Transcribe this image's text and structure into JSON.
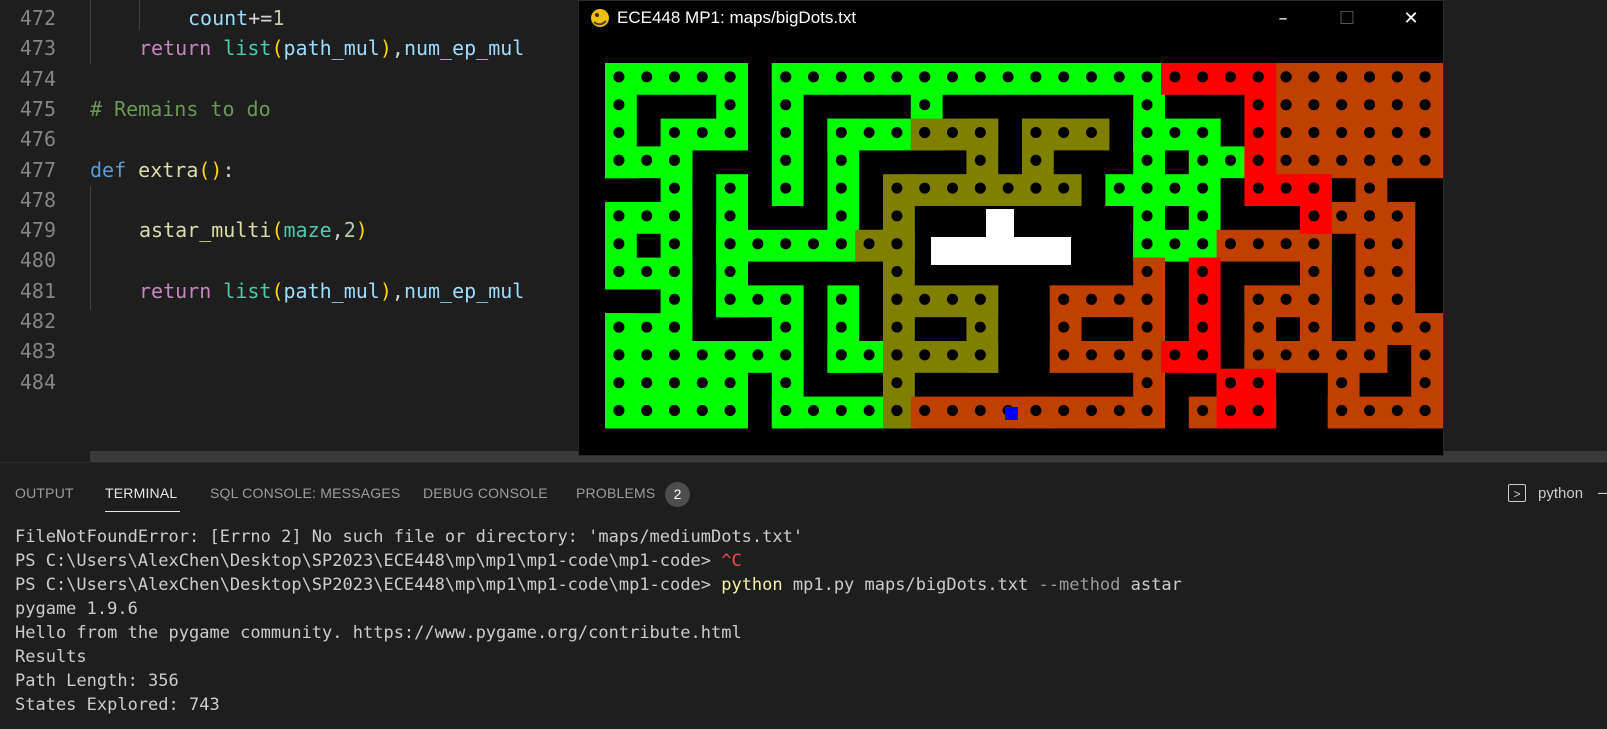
{
  "editor": {
    "lines": [
      {
        "num": "472",
        "indent": 4,
        "tokens": [
          [
            "var",
            "count"
          ],
          [
            "plain",
            "+="
          ],
          [
            "num",
            "1"
          ]
        ]
      },
      {
        "num": "473",
        "indent": 2,
        "tokens": [
          [
            "kw-ret",
            "return"
          ],
          [
            "plain",
            " "
          ],
          [
            "teal",
            "list"
          ],
          [
            "br",
            "("
          ],
          [
            "var",
            "path_mul"
          ],
          [
            "br",
            ")"
          ],
          [
            "plain",
            ","
          ],
          [
            "var",
            "num_ep_mul"
          ]
        ]
      },
      {
        "num": "474",
        "indent": 0,
        "tokens": []
      },
      {
        "num": "475",
        "indent": 0,
        "tokens": [
          [
            "cmt",
            "# Remains to do"
          ]
        ]
      },
      {
        "num": "476",
        "indent": 0,
        "tokens": []
      },
      {
        "num": "477",
        "indent": 0,
        "tokens": [
          [
            "kw-def",
            "def"
          ],
          [
            "plain",
            " "
          ],
          [
            "fn",
            "extra"
          ],
          [
            "br",
            "()"
          ],
          [
            "plain",
            ":"
          ]
        ]
      },
      {
        "num": "478",
        "indent": 0,
        "tokens": []
      },
      {
        "num": "479",
        "indent": 2,
        "tokens": [
          [
            "fn",
            "astar_multi"
          ],
          [
            "br",
            "("
          ],
          [
            "teal",
            "maze"
          ],
          [
            "plain",
            ","
          ],
          [
            "num",
            "2"
          ],
          [
            "br",
            ")"
          ]
        ]
      },
      {
        "num": "480",
        "indent": 0,
        "tokens": []
      },
      {
        "num": "481",
        "indent": 2,
        "tokens": [
          [
            "kw-ret",
            "return"
          ],
          [
            "plain",
            " "
          ],
          [
            "teal",
            "list"
          ],
          [
            "br",
            "("
          ],
          [
            "var",
            "path_mul"
          ],
          [
            "br",
            ")"
          ],
          [
            "plain",
            ","
          ],
          [
            "var",
            "num_ep_mul"
          ]
        ]
      },
      {
        "num": "482",
        "indent": 0,
        "tokens": []
      },
      {
        "num": "483",
        "indent": 0,
        "tokens": []
      },
      {
        "num": "484",
        "indent": 0,
        "tokens": []
      }
    ]
  },
  "game_window": {
    "title": "ECE448 MP1: maps/bigDots.txt",
    "minimize_icon": "minimize-icon",
    "maximize_icon": "maximize-icon",
    "close_icon": "close-icon",
    "colors": {
      "green": "#00ff00",
      "olive": "#7f7f00",
      "orange": "#c04000",
      "red": "#ff0000",
      "agent": "#0000ff",
      "wall": "#000000",
      "dot": "#000000"
    }
  },
  "panel": {
    "tabs": [
      "OUTPUT",
      "TERMINAL",
      "SQL CONSOLE: MESSAGES",
      "DEBUG CONSOLE",
      "PROBLEMS"
    ],
    "active_tab": "TERMINAL",
    "problems_count": "2",
    "terminal_name": "python",
    "terminal_icon": "terminal-icon"
  },
  "terminal": {
    "error_line": "FileNotFoundError: [Errno 2] No such file or directory: 'maps/mediumDots.txt'",
    "prompt": "PS C:\\Users\\AlexChen\\Desktop\\SP2023\\ECE448\\mp\\mp1\\mp1-code\\mp1-code> ",
    "ctrl_c": "^C",
    "cmd_program": "python",
    "cmd_args": " mp1.py maps/bigDots.txt ",
    "cmd_flag": "--method",
    "cmd_value": " astar",
    "out1": "pygame 1.9.6",
    "out2": "Hello from the pygame community. https://www.pygame.org/contribute.html",
    "out3": "Results",
    "out4": "Path Length: 356",
    "out5": "States Explored: 743"
  }
}
